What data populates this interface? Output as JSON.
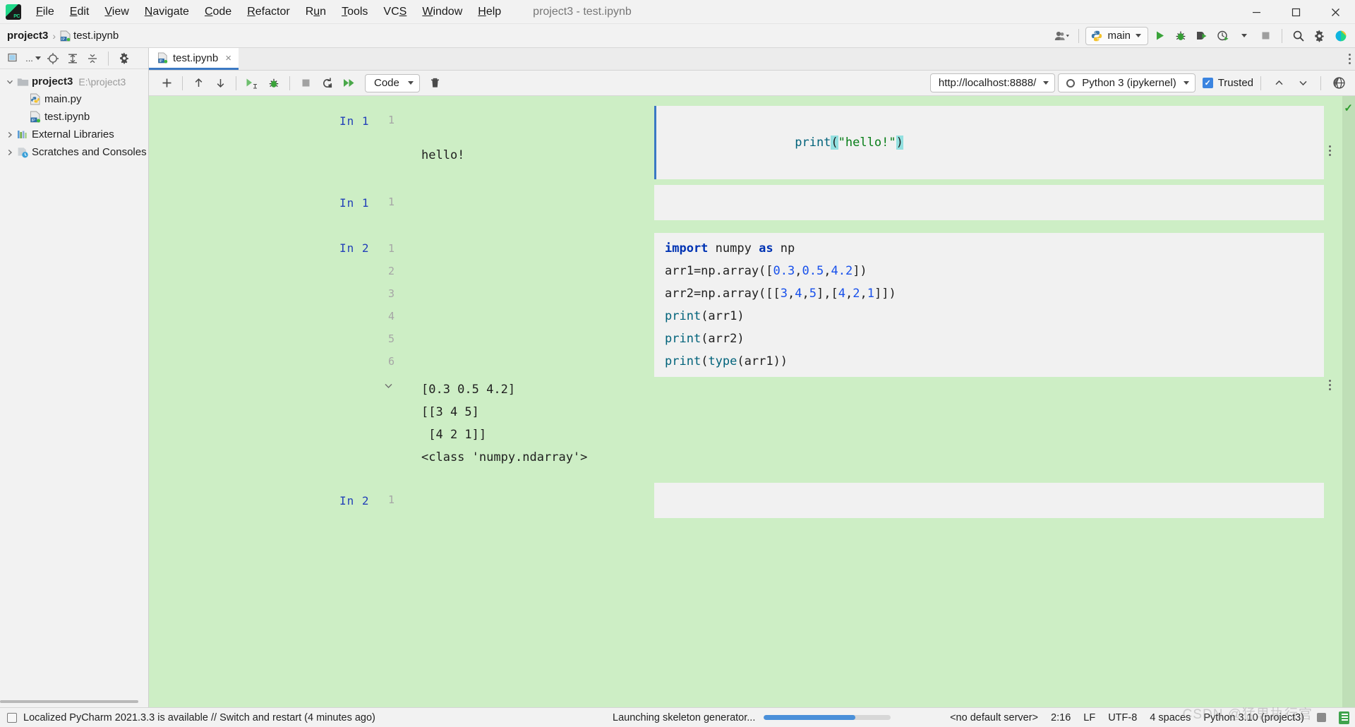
{
  "window": {
    "title": "project3 - test.ipynb",
    "minimize_label": "Minimize",
    "maximize_label": "Maximize",
    "close_label": "Close"
  },
  "menu": {
    "items": [
      {
        "label": "File",
        "mnemonic": "F"
      },
      {
        "label": "Edit",
        "mnemonic": "E"
      },
      {
        "label": "View",
        "mnemonic": "V"
      },
      {
        "label": "Navigate",
        "mnemonic": "N"
      },
      {
        "label": "Code",
        "mnemonic": "C"
      },
      {
        "label": "Refactor",
        "mnemonic": "R"
      },
      {
        "label": "Run",
        "mnemonic": "u"
      },
      {
        "label": "Tools",
        "mnemonic": "T"
      },
      {
        "label": "VCS",
        "mnemonic": "S"
      },
      {
        "label": "Window",
        "mnemonic": "W"
      },
      {
        "label": "Help",
        "mnemonic": "H"
      }
    ]
  },
  "navbar": {
    "breadcrumb": {
      "project": "project3",
      "separator": "›",
      "file": "test.ipynb"
    },
    "run_config": {
      "name": "main",
      "icon": "python-icon"
    },
    "actions": [
      {
        "name": "user-account-button",
        "label": "Account"
      },
      {
        "name": "run-button",
        "label": "Run"
      },
      {
        "name": "debug-button",
        "label": "Debug"
      },
      {
        "name": "run-with-coverage-button",
        "label": "Run with Coverage"
      },
      {
        "name": "profile-button",
        "label": "Profile"
      },
      {
        "name": "stop-button",
        "label": "Stop"
      },
      {
        "name": "search-everywhere-button",
        "label": "Search Everywhere"
      },
      {
        "name": "settings-button",
        "label": "Settings"
      },
      {
        "name": "ide-feature-button",
        "label": "IDE Features"
      }
    ]
  },
  "project_panel": {
    "toolbar": [
      {
        "name": "project-view-selector",
        "label": "Project"
      },
      {
        "name": "locate-file-button",
        "label": "Select Opened File"
      },
      {
        "name": "expand-all-button",
        "label": "Expand All"
      },
      {
        "name": "collapse-all-button",
        "label": "Collapse All"
      },
      {
        "name": "panel-settings-button",
        "label": "Options"
      }
    ],
    "tree": [
      {
        "label": "project3",
        "path": "E:\\project3",
        "icon": "folder-icon",
        "expanded": true,
        "depth": 0,
        "bold": true,
        "twisty": "v"
      },
      {
        "label": "main.py",
        "path": "",
        "icon": "python-file-icon",
        "expanded": false,
        "depth": 1,
        "bold": false,
        "twisty": ""
      },
      {
        "label": "test.ipynb",
        "path": "",
        "icon": "notebook-file-icon",
        "expanded": false,
        "depth": 1,
        "bold": false,
        "twisty": ""
      },
      {
        "label": "External Libraries",
        "path": "",
        "icon": "libraries-icon",
        "expanded": false,
        "depth": 0,
        "bold": false,
        "twisty": ">"
      },
      {
        "label": "Scratches and Consoles",
        "path": "",
        "icon": "scratches-icon",
        "expanded": false,
        "depth": 0,
        "bold": false,
        "twisty": ">"
      }
    ]
  },
  "editor": {
    "tab": {
      "label": "test.ipynb",
      "icon": "notebook-file-icon",
      "close": "×"
    },
    "notebook_toolbar": {
      "buttons": [
        {
          "name": "add-cell-button",
          "label": "Add Cell"
        },
        {
          "name": "move-cell-up-button",
          "label": "Move Cell Up"
        },
        {
          "name": "move-cell-down-button",
          "label": "Move Cell Down"
        },
        {
          "name": "run-cell-button",
          "label": "Run Cell and Select Below"
        },
        {
          "name": "debug-cell-button",
          "label": "Debug Cell"
        },
        {
          "name": "interrupt-kernel-button",
          "label": "Interrupt Kernel"
        },
        {
          "name": "restart-kernel-button",
          "label": "Restart Kernel"
        },
        {
          "name": "run-all-cells-button",
          "label": "Run All Cells"
        },
        {
          "name": "delete-cell-button",
          "label": "Delete Cell"
        }
      ],
      "cell_type": "Code",
      "server_url": "http://localhost:8888/",
      "kernel": "Python 3 (ipykernel)",
      "trusted_label": "Trusted",
      "trusted_checked": true,
      "nav_up_label": "Previous Cell",
      "nav_down_label": "Next Cell",
      "browser_label": "Open in Browser"
    },
    "cells": [
      {
        "id": "cell-1",
        "prompt": "In 1",
        "selected": true,
        "lines": [
          {
            "num": "1",
            "tokens": [
              {
                "t": "print",
                "c": "fn"
              },
              {
                "t": "(",
                "c": "paren-hl"
              },
              {
                "t": "\"hello!\"",
                "c": "str"
              },
              {
                "t": ")",
                "c": "paren-hl"
              }
            ]
          }
        ],
        "output": [
          "hello!"
        ],
        "has_output_menu": true,
        "has_collapse": false
      },
      {
        "id": "cell-2",
        "prompt": "In 1",
        "selected": false,
        "lines": [
          {
            "num": "1",
            "tokens": [
              {
                "t": "",
                "c": ""
              }
            ]
          }
        ],
        "output": [],
        "has_output_menu": false,
        "has_collapse": false
      },
      {
        "id": "cell-3",
        "prompt": "In 2",
        "selected": false,
        "lines": [
          {
            "num": "1",
            "tokens": [
              {
                "t": "import",
                "c": "kw"
              },
              {
                "t": " numpy ",
                "c": ""
              },
              {
                "t": "as",
                "c": "kw"
              },
              {
                "t": " np",
                "c": ""
              }
            ]
          },
          {
            "num": "2",
            "tokens": [
              {
                "t": "arr1=np.array([",
                "c": ""
              },
              {
                "t": "0.3",
                "c": "num"
              },
              {
                "t": ",",
                "c": ""
              },
              {
                "t": "0.5",
                "c": "num"
              },
              {
                "t": ",",
                "c": ""
              },
              {
                "t": "4.2",
                "c": "num"
              },
              {
                "t": "])",
                "c": ""
              }
            ]
          },
          {
            "num": "3",
            "tokens": [
              {
                "t": "arr2=np.array([[",
                "c": ""
              },
              {
                "t": "3",
                "c": "num"
              },
              {
                "t": ",",
                "c": ""
              },
              {
                "t": "4",
                "c": "num"
              },
              {
                "t": ",",
                "c": ""
              },
              {
                "t": "5",
                "c": "num"
              },
              {
                "t": "],[",
                "c": ""
              },
              {
                "t": "4",
                "c": "num"
              },
              {
                "t": ",",
                "c": ""
              },
              {
                "t": "2",
                "c": "num"
              },
              {
                "t": ",",
                "c": ""
              },
              {
                "t": "1",
                "c": "num"
              },
              {
                "t": "]])",
                "c": ""
              }
            ]
          },
          {
            "num": "4",
            "tokens": [
              {
                "t": "print",
                "c": "fn"
              },
              {
                "t": "(arr1)",
                "c": ""
              }
            ]
          },
          {
            "num": "5",
            "tokens": [
              {
                "t": "print",
                "c": "fn"
              },
              {
                "t": "(arr2)",
                "c": ""
              }
            ]
          },
          {
            "num": "6",
            "tokens": [
              {
                "t": "print",
                "c": "fn"
              },
              {
                "t": "(",
                "c": ""
              },
              {
                "t": "type",
                "c": "fn"
              },
              {
                "t": "(arr1))",
                "c": ""
              }
            ]
          }
        ],
        "output": [
          "[0.3 0.5 4.2]",
          "[[3 4 5]",
          " [4 2 1]]",
          "<class 'numpy.ndarray'>"
        ],
        "has_output_menu": true,
        "has_collapse": true
      },
      {
        "id": "cell-4",
        "prompt": "In 2",
        "selected": false,
        "lines": [
          {
            "num": "1",
            "tokens": [
              {
                "t": "",
                "c": ""
              }
            ]
          }
        ],
        "output": [],
        "has_output_menu": false,
        "has_collapse": false
      }
    ]
  },
  "statusbar": {
    "notification": "Localized PyCharm 2021.3.3 is available // Switch and restart (4 minutes ago)",
    "progress_text": "Launching skeleton generator...",
    "progress_percent": 72,
    "server": "<no default server>",
    "caret": "2:16",
    "line_separator": "LF",
    "encoding": "UTF-8",
    "indent": "4 spaces",
    "interpreter": "Python 3.10 (project3)",
    "watermark": "CSDN @猛思执行官"
  },
  "colors": {
    "notebook_background": "#cdeec5",
    "cell_editor_background": "#f1f1f1",
    "selected_cell_border": "#3b79c4",
    "accent_blue": "#3b84e0",
    "keyword": "#0033b3",
    "string": "#067d17",
    "number": "#1750eb",
    "function": "#00627a",
    "prompt": "#2441b8",
    "paren_highlight": "#93e0e0"
  }
}
